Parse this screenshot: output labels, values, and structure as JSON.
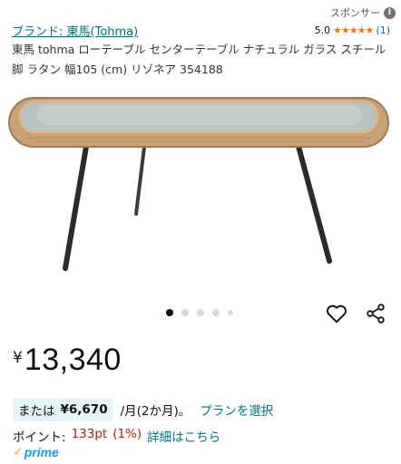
{
  "sponsor": {
    "label": "スポンサー",
    "icon": "info-icon"
  },
  "brand": {
    "label": "ブランド: 東馬(Tohma)"
  },
  "rating": {
    "score": "5.0",
    "stars": "★★★★★",
    "count": "(1)"
  },
  "product": {
    "title": "東馬 tohma ローテーブル センターテーブル ナチュラル ガラス スチール脚 ラタン 幅105 (cm) リゾネア 354188"
  },
  "carousel": {
    "total": 5,
    "active": 1
  },
  "price": {
    "currency": "¥",
    "amount": "13,340"
  },
  "installment": {
    "prefix": "または",
    "value": "¥6,670",
    "period": "/月(2か月)。",
    "plan_link": "プランを選択"
  },
  "points": {
    "label": "ポイント:",
    "value": "133pt",
    "percent": "(1%)",
    "detail_link": "詳細はこちら"
  },
  "prime": {
    "check": "✓",
    "label": "prime"
  },
  "colors": {
    "link": "#007185",
    "star": "#de7921",
    "price_red": "#b12704",
    "prime_blue": "#1399ff",
    "pill_bg": "#e7f4f6"
  }
}
